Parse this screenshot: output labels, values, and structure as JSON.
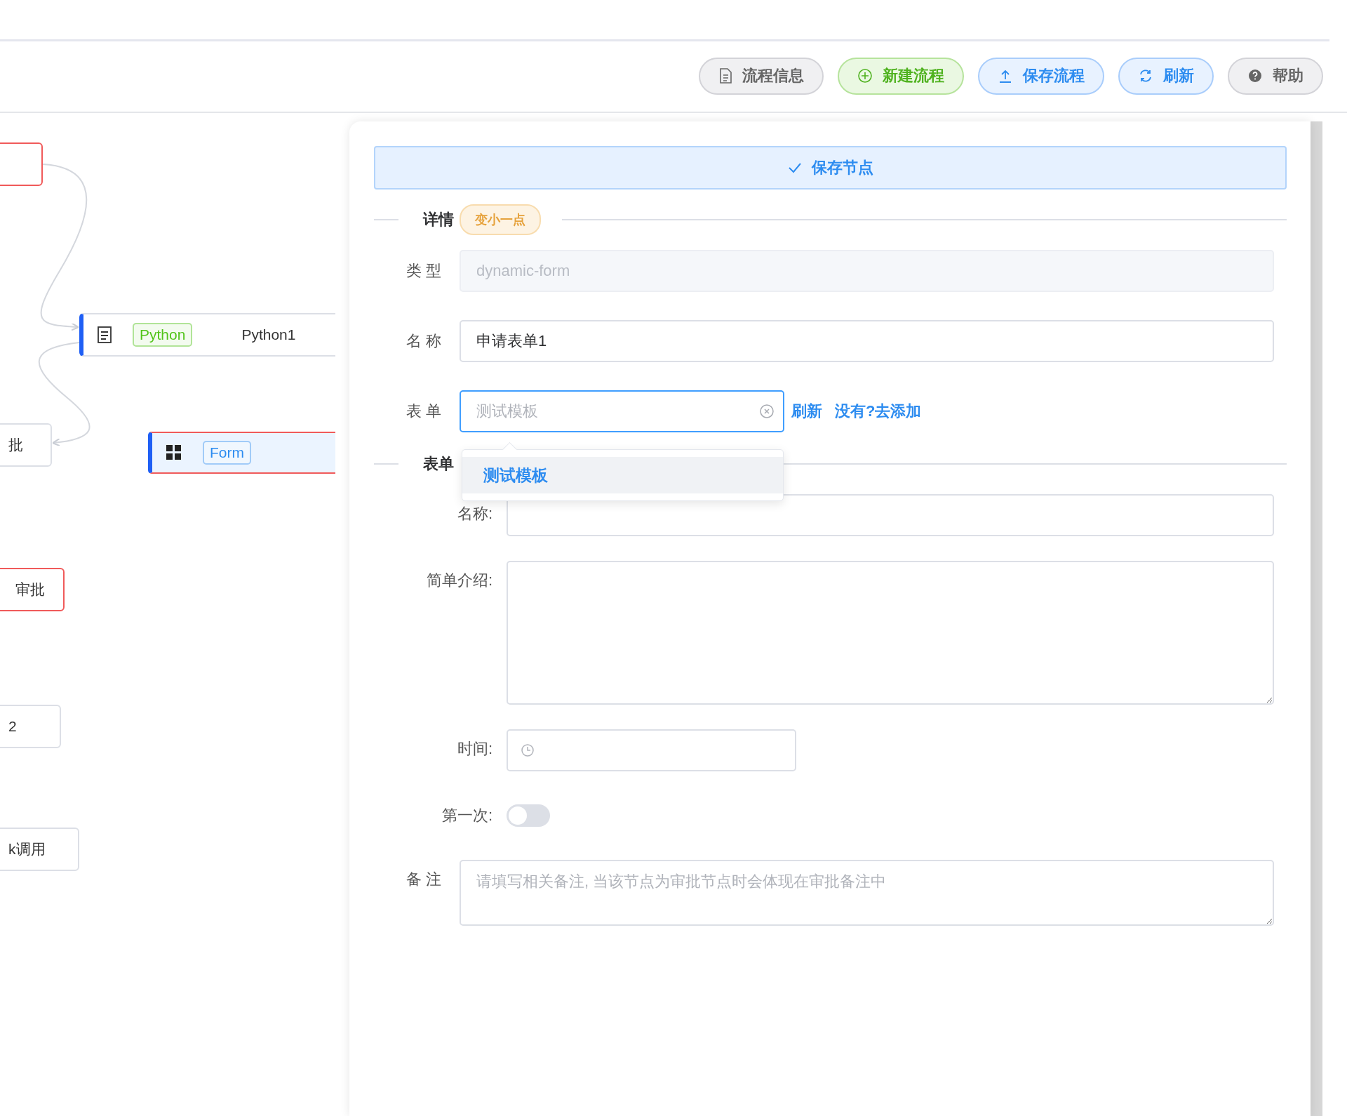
{
  "toolbar": {
    "buttons": [
      {
        "label": "流程信息",
        "kind": "default"
      },
      {
        "label": "新建流程",
        "kind": "success"
      },
      {
        "label": "保存流程",
        "kind": "primary"
      },
      {
        "label": "刷新",
        "kind": "primary"
      },
      {
        "label": "帮助",
        "kind": "default"
      }
    ]
  },
  "canvas": {
    "nodes": [
      {
        "kind": "plain",
        "error": true
      },
      {
        "kind": "task",
        "error": false,
        "selected": false,
        "tag": {
          "label": "Python",
          "color": "#52c41a"
        },
        "text": "Python1"
      },
      {
        "kind": "plain",
        "error": false,
        "text": "批"
      },
      {
        "kind": "task",
        "error": true,
        "selected": true,
        "tag": {
          "label": "Form",
          "color": "#2d8cf0"
        }
      },
      {
        "kind": "plain",
        "error": true,
        "text": "审批"
      },
      {
        "kind": "plain",
        "error": false,
        "text": "2"
      },
      {
        "kind": "plain",
        "error": false,
        "text": "k调用"
      }
    ]
  },
  "panel": {
    "save_button": "保存节点",
    "details": {
      "title": "详情",
      "badge": "变小一点"
    },
    "fields": [
      {
        "label": "类型",
        "kind": "text",
        "value": "dynamic-form",
        "disabled": true
      },
      {
        "label": "名称",
        "kind": "text",
        "value": "申请表单1",
        "disabled": false
      },
      {
        "label": "表单",
        "kind": "select",
        "placeholder": "测试模板",
        "focused": true,
        "links": [
          "刷新",
          "没有?去添加"
        ]
      }
    ],
    "dropdown": {
      "options": [
        {
          "label": "测试模板",
          "selected": true
        }
      ]
    },
    "form_section": {
      "title": "表单",
      "fields": [
        {
          "label": "名称:",
          "kind": "text"
        },
        {
          "label": "简单介绍:",
          "kind": "textarea"
        },
        {
          "label": "时间:",
          "kind": "time"
        },
        {
          "label": "第一次:",
          "kind": "switch",
          "on": false
        }
      ]
    },
    "remark": {
      "label": "备注",
      "placeholder": "请填写相关备注, 当该节点为审批节点时会体现在审批备注中"
    }
  }
}
